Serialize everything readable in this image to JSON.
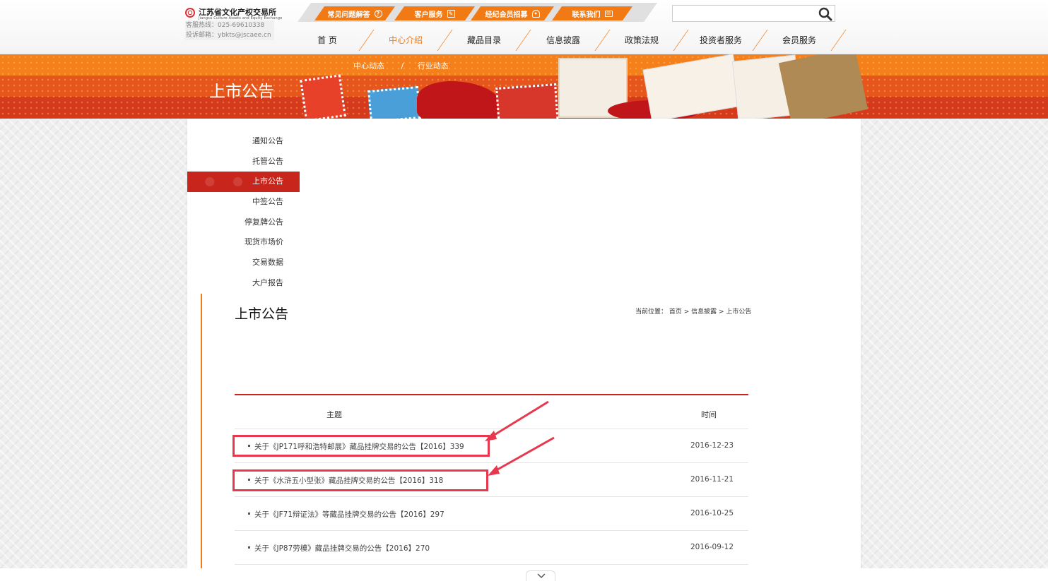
{
  "header": {
    "logo_name": "江苏省文化产权交易所",
    "logo_sub": "Jiangsu Culture Assets and Equity Exchange",
    "hotline": "客服热线：025-69610338",
    "complaint_email": "投诉邮箱：ybkts@jscaee.cn",
    "quick_links": [
      {
        "label": "常见问题解答",
        "icon": "question-icon"
      },
      {
        "label": "客户服务",
        "icon": "edit-icon"
      },
      {
        "label": "经纪会员招募",
        "icon": "user-icon"
      },
      {
        "label": "联系我们",
        "icon": "mail-icon"
      }
    ],
    "search": {
      "placeholder": "",
      "icon": "search-icon"
    }
  },
  "nav": {
    "items": [
      "首 页",
      "中心介绍",
      "藏品目录",
      "信息披露",
      "政策法规",
      "投资者服务",
      "会员服务"
    ],
    "active": "中心介绍"
  },
  "banner": {
    "title": "上市公告",
    "subnav": [
      "中心动态",
      "/",
      "行业动态"
    ]
  },
  "side_menu": {
    "items": [
      "通知公告",
      "托管公告",
      "上市公告",
      "中签公告",
      "停复牌公告",
      "现货市场价",
      "交易数据",
      "大户报告"
    ],
    "active": "上市公告"
  },
  "content": {
    "title": "上市公告",
    "breadcrumb": "当前位置： 首页 > 信息披露 > 上市公告"
  },
  "table": {
    "headers": {
      "subject": "主题",
      "time": "时间"
    },
    "rows": [
      {
        "title": "关于《JP171呼和浩特邮展》藏品挂牌交易的公告【2016】339",
        "date": "2016-12-23"
      },
      {
        "title": "关于《水浒五小型张》藏品挂牌交易的公告【2016】318",
        "date": "2016-11-21"
      },
      {
        "title": "关于《JF71辩证法》等藏品挂牌交易的公告【2016】297",
        "date": "2016-10-25"
      },
      {
        "title": "关于《JP87劳模》藏品挂牌交易的公告【2016】270",
        "date": "2016-09-12"
      }
    ]
  },
  "colors": {
    "accent": "#f27a14",
    "red": "#c8261c",
    "annotation": "#e8384f"
  }
}
